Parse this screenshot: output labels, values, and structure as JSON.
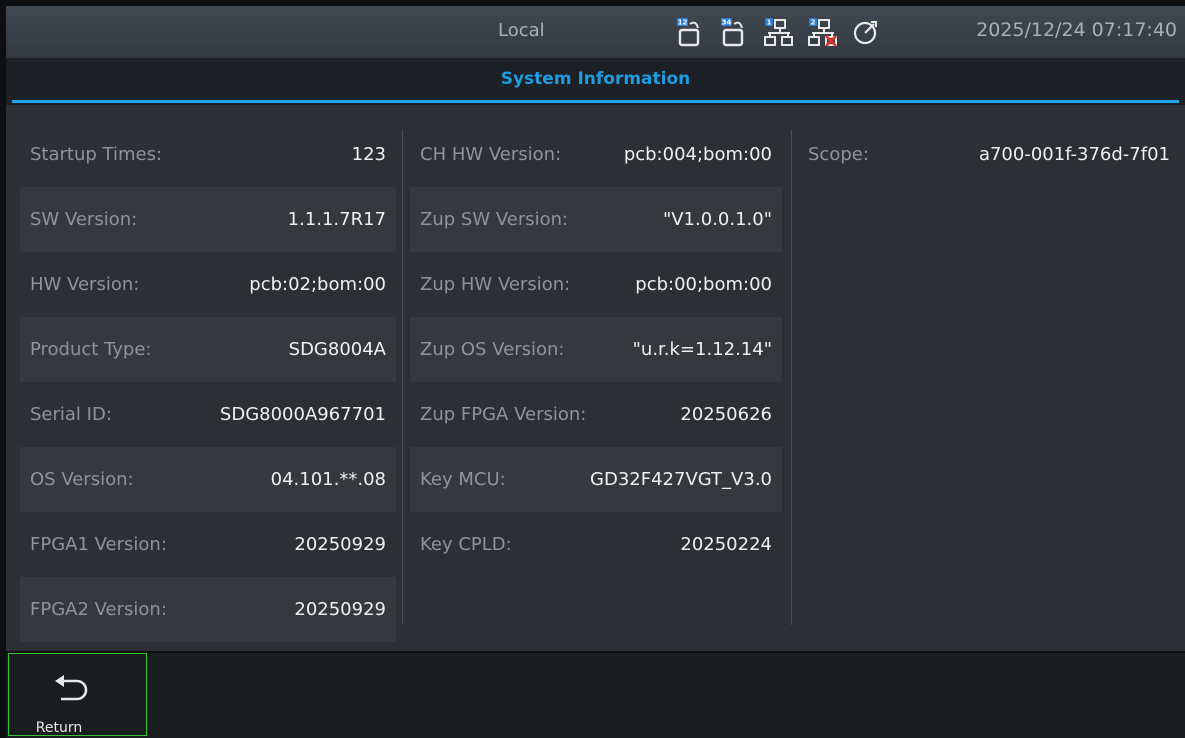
{
  "header": {
    "mode": "Local",
    "datetime": "2025/12/24 07:17:40",
    "status_icons": [
      "usb-12-icon",
      "usb-34-icon",
      "lan-1-icon",
      "lan-2-disconnected-icon",
      "timer-icon"
    ]
  },
  "page": {
    "title": "System Information"
  },
  "column1": [
    {
      "label": "Startup Times:",
      "value": "123"
    },
    {
      "label": "SW Version:",
      "value": "1.1.1.7R17"
    },
    {
      "label": "HW Version:",
      "value": "pcb:02;bom:00"
    },
    {
      "label": "Product Type:",
      "value": "SDG8004A"
    },
    {
      "label": "Serial ID:",
      "value": "SDG8000A967701"
    },
    {
      "label": "OS Version:",
      "value": "04.101.**.08"
    },
    {
      "label": "FPGA1 Version:",
      "value": "20250929"
    },
    {
      "label": "FPGA2 Version:",
      "value": "20250929"
    }
  ],
  "column2": [
    {
      "label": "CH HW Version:",
      "value": "pcb:004;bom:00"
    },
    {
      "label": "Zup SW Version:",
      "value": "\"V1.0.0.1.0\""
    },
    {
      "label": "Zup HW Version:",
      "value": "pcb:00;bom:00"
    },
    {
      "label": "Zup OS Version:",
      "value": "\"u.r.k=1.12.14\""
    },
    {
      "label": "Zup FPGA Version:",
      "value": "20250626"
    },
    {
      "label": "Key MCU:",
      "value": "GD32F427VGT_V3.0"
    },
    {
      "label": "Key CPLD:",
      "value": "20250224"
    }
  ],
  "column3": [
    {
      "label": "Scope:",
      "value": "a700-001f-376d-7f01"
    }
  ],
  "footer": {
    "return_label": "Return",
    "return_icon": "return-arrow-icon"
  },
  "colors": {
    "accent": "#1ea6ea",
    "title": "#1f9be0",
    "focus": "#35c233",
    "disconnected": "#e0342b"
  }
}
